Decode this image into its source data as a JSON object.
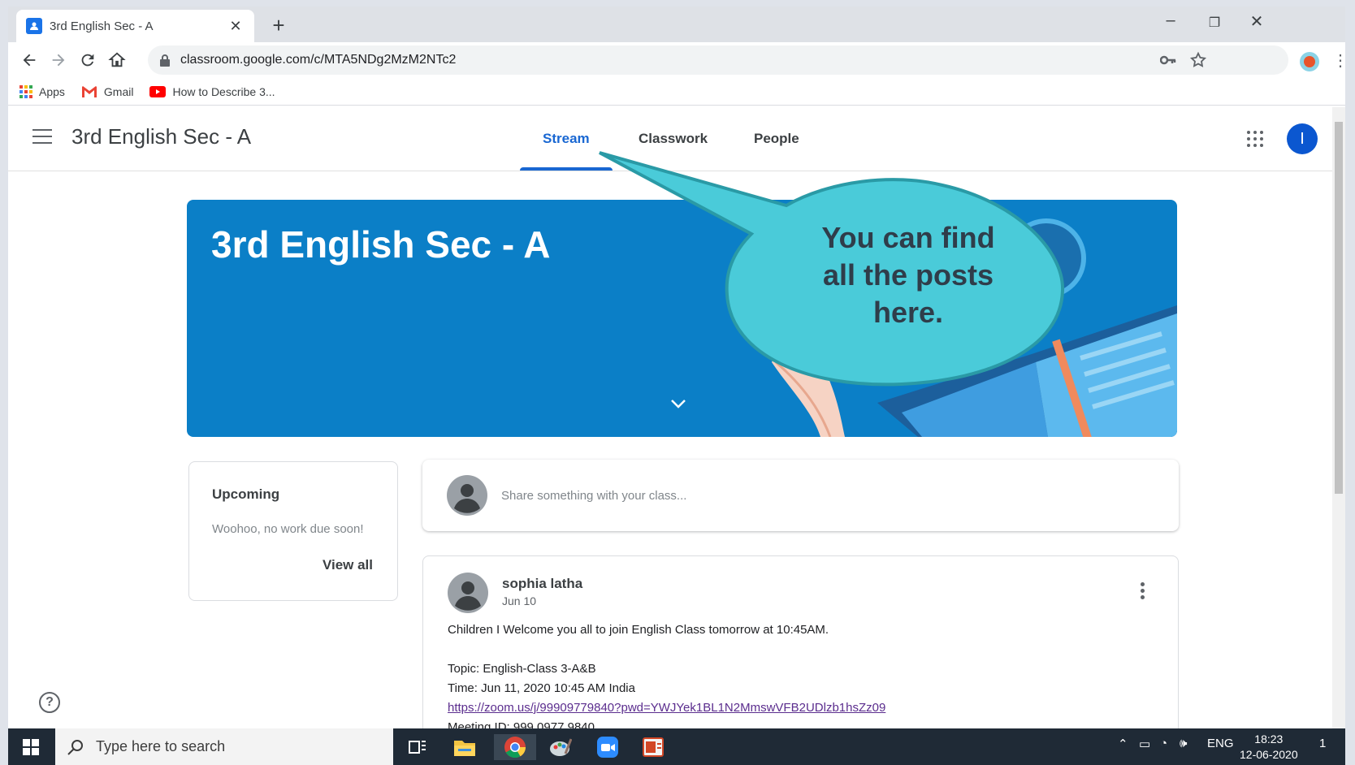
{
  "browser": {
    "tab_title": "3rd English Sec - A",
    "tab_close": "✕",
    "new_tab": "+",
    "url": "classroom.google.com/c/MTA5NDg2MzM2NTc2",
    "window_controls": {
      "minimize": "–",
      "restore": "❐",
      "close": "✕"
    },
    "bookmarks": [
      {
        "label": "Apps",
        "icon": "apps-grid-icon"
      },
      {
        "label": "Gmail",
        "icon": "gmail-icon"
      },
      {
        "label": "How to Describe 3...",
        "icon": "youtube-icon"
      }
    ]
  },
  "classroom": {
    "class_name": "3rd English Sec - A",
    "tabs": [
      {
        "label": "Stream",
        "active": true
      },
      {
        "label": "Classwork",
        "active": false
      },
      {
        "label": "People",
        "active": false
      }
    ],
    "user_initial": "I",
    "banner_title": "3rd English Sec - A",
    "upcoming": {
      "heading": "Upcoming",
      "message": "Woohoo, no work due soon!",
      "view_all": "View all"
    },
    "share_placeholder": "Share something with your class...",
    "post": {
      "author": "sophia latha",
      "date": "Jun 10",
      "lines": [
        "Children I Welcome you all to join English Class tomorrow at 10:45AM.",
        "Topic: English-Class 3-A&B",
        "Time: Jun 11, 2020 10:45 AM India",
        "https://zoom.us/j/99909779840?pwd=YWJYek1BL1N2MmswVFB2UDlzb1hsZz09",
        "Meeting ID: 999 0977 9840"
      ]
    },
    "help": "?"
  },
  "callout": {
    "line1": "You can find",
    "line2": "all the posts",
    "line3": "here."
  },
  "taskbar": {
    "search_placeholder": "Type here to search",
    "language": "ENG",
    "time": "18:23",
    "date": "12-06-2020",
    "notification_count": "1"
  },
  "colors": {
    "accent": "#1967d2",
    "banner": "#0b7fc7",
    "callout_fill": "#4acbd9",
    "callout_stroke": "#2a9aa6"
  }
}
